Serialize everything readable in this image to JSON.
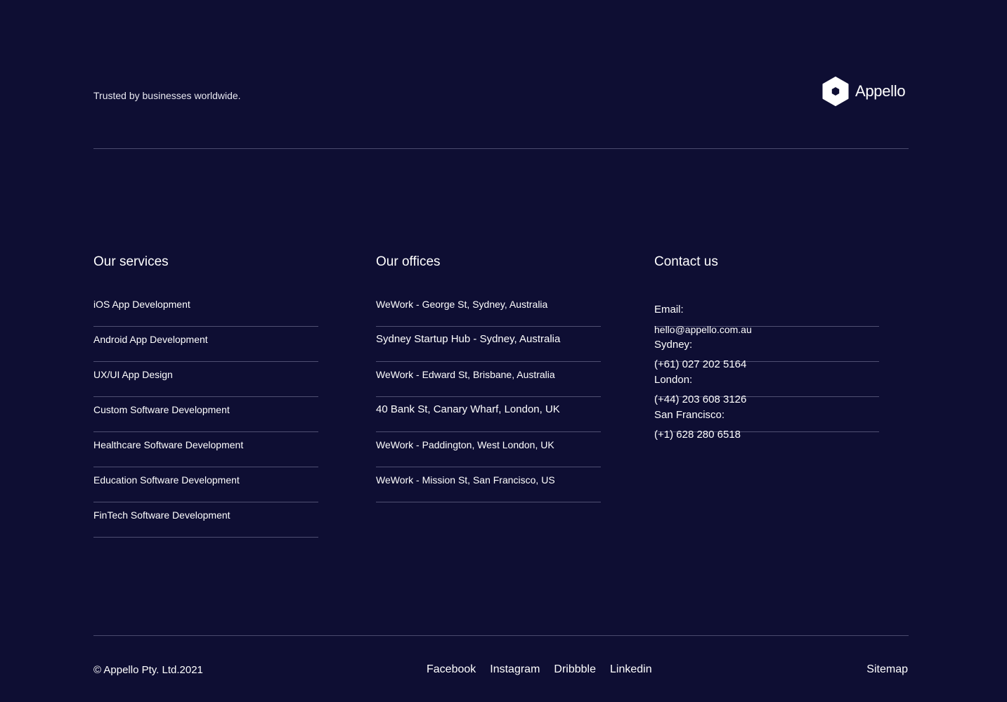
{
  "header": {
    "tagline": "Trusted by businesses worldwide.",
    "logo_text": "Appello",
    "logo_icon": "hexagon-logo-icon"
  },
  "services": {
    "title": "Our services",
    "items": [
      "iOS App Development",
      "Android App Development",
      "UX/UI App Design",
      "Custom Software Development",
      "Healthcare Software Development",
      "Education Software Development",
      "FinTech Software Development"
    ]
  },
  "offices": {
    "title": "Our offices",
    "items": [
      "WeWork - George St, Sydney, Australia",
      "Sydney Startup Hub - Sydney, Australia",
      "WeWork - Edward St, Brisbane, Australia",
      "40 Bank St, Canary Wharf, London, UK",
      "WeWork - Paddington, West London, UK",
      "WeWork - Mission St, San Francisco, US"
    ]
  },
  "contact": {
    "title": "Contact us",
    "items": [
      {
        "label": "Email:",
        "value": "hello@appello.com.au"
      },
      {
        "label": "Sydney:",
        "value": "(+61) 027 202 5164"
      },
      {
        "label": "London:",
        "value": "(+44) 203 608 3126"
      },
      {
        "label": "San Francisco:",
        "value": "(+1) 628 280 6518"
      }
    ]
  },
  "footer": {
    "copyright": "© Appello Pty. Ltd.2021",
    "social": [
      "Facebook",
      "Instagram",
      "Dribbble",
      "Linkedin"
    ],
    "sitemap": "Sitemap"
  },
  "colors": {
    "background": "#0e0e33",
    "divider": "#4a4a6e",
    "text": "#ffffff"
  }
}
